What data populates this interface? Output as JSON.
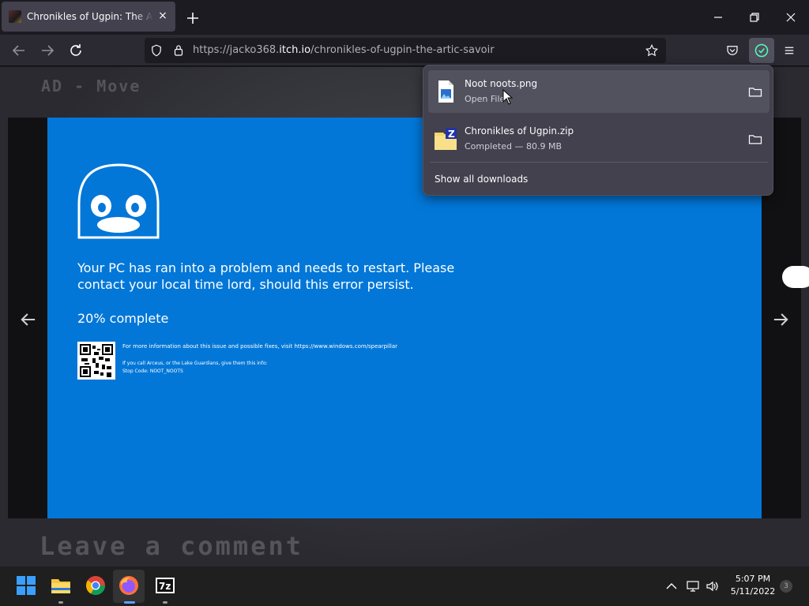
{
  "browser": {
    "tab_title": "Chronikles of Ugpin: The Artic Savoir",
    "tab_close": "×",
    "url_prefix": "https://jacko368.",
    "url_host": "itch.io",
    "url_path": "/chronikles-of-ugpin-the-artic-savoir"
  },
  "page": {
    "controls_hint": "AD - Move",
    "comment_heading": "Leave a comment",
    "bsod": {
      "message": "Your PC has ran into a problem and needs to restart. Please contact your local time lord, should this error persist.",
      "progress": "20% complete",
      "progress_fraction": 0.2,
      "info_line": "For more information about this issue and possible fixes, visit https://www.windows.com/spearpillar",
      "guardians_line": "If you call Arceus, or the Lake Guardians, give them this info:",
      "stop_code": "Stop Code: NOOT_NOOTS"
    }
  },
  "downloads": {
    "items": [
      {
        "name": "Noot noots.png",
        "status": "Open File",
        "icon": "image-file-icon"
      },
      {
        "name": "Chronikles of Ugpin.zip",
        "status": "Completed — 80.9 MB",
        "icon": "zip-archive-icon"
      }
    ],
    "show_all": "Show all downloads"
  },
  "taskbar": {
    "apps": [
      "start-icon",
      "file-explorer-icon",
      "chrome-icon",
      "firefox-icon",
      "7zip-icon"
    ],
    "seven_zip_label": "7z",
    "time": "5:07 PM",
    "date": "5/11/2022",
    "notifications": "3"
  },
  "colors": {
    "bsod_blue": "#0277d8",
    "browser_dark": "#1c1b22",
    "panel": "#42414d",
    "accent": "#54ffbd"
  }
}
